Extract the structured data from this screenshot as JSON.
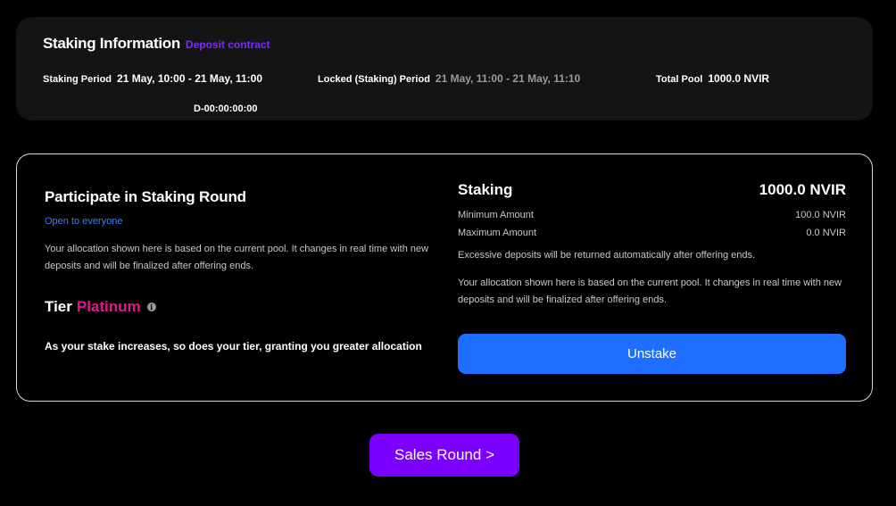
{
  "info": {
    "title": "Staking Information",
    "deposit_link": "Deposit contract",
    "staking_period_label": "Staking Period",
    "staking_period_value": "21 May, 10:00 - 21 May, 11:00",
    "countdown": "D-00:00:00:00",
    "locked_period_label": "Locked (Staking) Period",
    "locked_period_value": "21 May, 11:00 - 21 May, 11:10",
    "total_pool_label": "Total Pool",
    "total_pool_value": "1000.0 NVIR"
  },
  "participate": {
    "title": "Participate in Staking Round",
    "open_text": "Open to everyone",
    "allocation_text": "Your allocation shown here is based on the current pool. It changes in real time with new deposits and will be finalized after offering ends.",
    "tier_label": "Tier",
    "tier_value": "Platinum",
    "info_icon": "i",
    "tier_desc": "As your stake increases, so does your tier, granting you greater allocation"
  },
  "staking": {
    "label": "Staking",
    "amount": "1000.0 NVIR",
    "min_label": "Minimum Amount",
    "min_value": "100.0 NVIR",
    "max_label": "Maximum Amount",
    "max_value": "0.0 NVIR",
    "excess_note": "Excessive deposits will be returned automatically after offering ends.",
    "allocation_text": "Your allocation shown here is based on the current pool. It changes in real time with new deposits and will be finalized after offering ends.",
    "unstake_label": "Unstake"
  },
  "sales_button_label": "Sales Round >",
  "colors": {
    "accent_purple": "#7b00ff",
    "accent_blue": "#1e6fff",
    "tier_pink": "#e0178f"
  }
}
